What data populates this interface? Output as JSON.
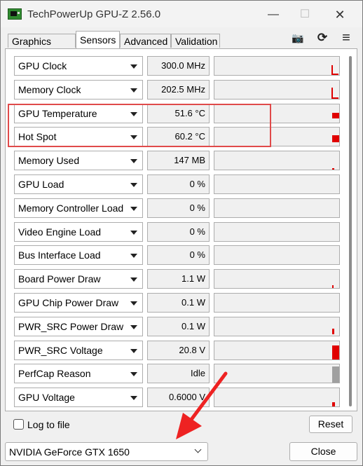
{
  "window": {
    "title": "TechPowerUp GPU-Z 2.56.0",
    "controls": {
      "minimize": "—",
      "maximize": "☐",
      "close": "✕"
    }
  },
  "tabs": [
    {
      "label": "Graphics Card",
      "active": false
    },
    {
      "label": "Sensors",
      "active": true
    },
    {
      "label": "Advanced",
      "active": false
    },
    {
      "label": "Validation",
      "active": false
    }
  ],
  "toolbar_icons": [
    "camera-icon",
    "refresh-icon",
    "menu-icon"
  ],
  "toolbar_glyphs": {
    "camera": "📷",
    "refresh": "⟳",
    "menu": "≡"
  },
  "sensors": [
    {
      "name": "GPU Clock",
      "value": "300.0 MHz"
    },
    {
      "name": "Memory Clock",
      "value": "202.5 MHz"
    },
    {
      "name": "GPU Temperature",
      "value": "51.6 °C"
    },
    {
      "name": "Hot Spot",
      "value": "60.2 °C"
    },
    {
      "name": "Memory Used",
      "value": "147 MB"
    },
    {
      "name": "GPU Load",
      "value": "0 %"
    },
    {
      "name": "Memory Controller Load",
      "value": "0 %"
    },
    {
      "name": "Video Engine Load",
      "value": "0 %"
    },
    {
      "name": "Bus Interface Load",
      "value": "0 %"
    },
    {
      "name": "Board Power Draw",
      "value": "1.1 W"
    },
    {
      "name": "GPU Chip Power Draw",
      "value": "0.1 W"
    },
    {
      "name": "PWR_SRC Power Draw",
      "value": "0.1 W"
    },
    {
      "name": "PWR_SRC Voltage",
      "value": "20.8 V"
    },
    {
      "name": "PerfCap Reason",
      "value": "Idle"
    },
    {
      "name": "GPU Voltage",
      "value": "0.6000 V"
    }
  ],
  "footer": {
    "log_label": "Log to file",
    "log_checked": false,
    "reset_label": "Reset",
    "gpu_selected": "NVIDIA GeForce GTX 1650",
    "close_label": "Close"
  },
  "colors": {
    "graph_red": "#e00000",
    "graph_gray": "#a0a0a0",
    "highlight": "#e04a4a",
    "annotation_arrow": "#ee2222"
  }
}
